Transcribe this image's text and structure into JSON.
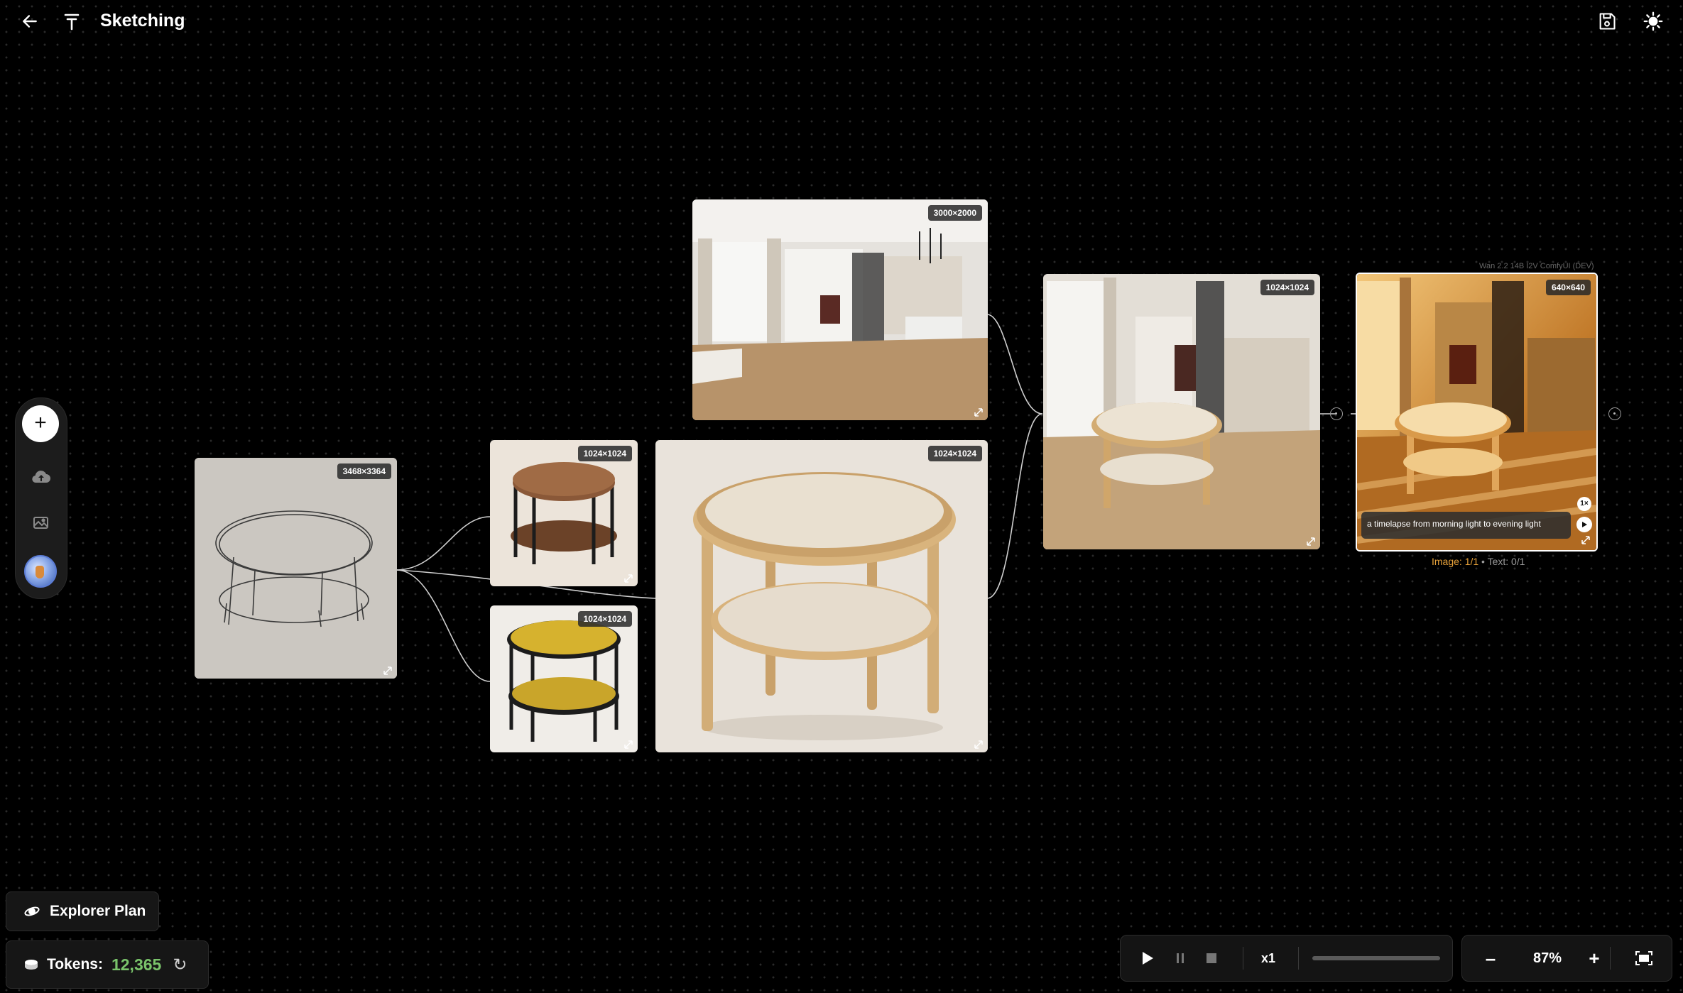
{
  "header": {
    "title": "Sketching",
    "back_icon": "arrow-left-icon",
    "logo_icon": "logo-icon",
    "save_icon": "save-icon",
    "theme_icon": "sun-icon"
  },
  "toolbar": {
    "add_label": "+",
    "upload_icon": "cloud-upload-icon",
    "gallery_icon": "image-gallery-icon",
    "avatar_icon": "avatar"
  },
  "nodes": {
    "sketch": {
      "dims": "3468×3364"
    },
    "walnut_table": {
      "dims": "1024×1024"
    },
    "yellow_table": {
      "dims": "1024×1024"
    },
    "oak_table": {
      "dims": "1024×1024"
    },
    "interior": {
      "dims": "3000×2000"
    },
    "composite": {
      "dims": "1024×1024"
    },
    "video": {
      "dims": "640×640",
      "model": "Wan 2.2 14B I2V ComfyUI (DEV)",
      "prompt": "a timelapse from morning light to evening light",
      "count": "1×",
      "status_image": "Image: 1/1",
      "status_sep": " • ",
      "status_text": "Text: 0/1"
    }
  },
  "plan": {
    "label": "Explorer Plan"
  },
  "tokens": {
    "label": "Tokens:",
    "value": "12,365"
  },
  "player": {
    "speed": "x1"
  },
  "zoom": {
    "minus": "–",
    "value": "87%",
    "plus": "+"
  }
}
